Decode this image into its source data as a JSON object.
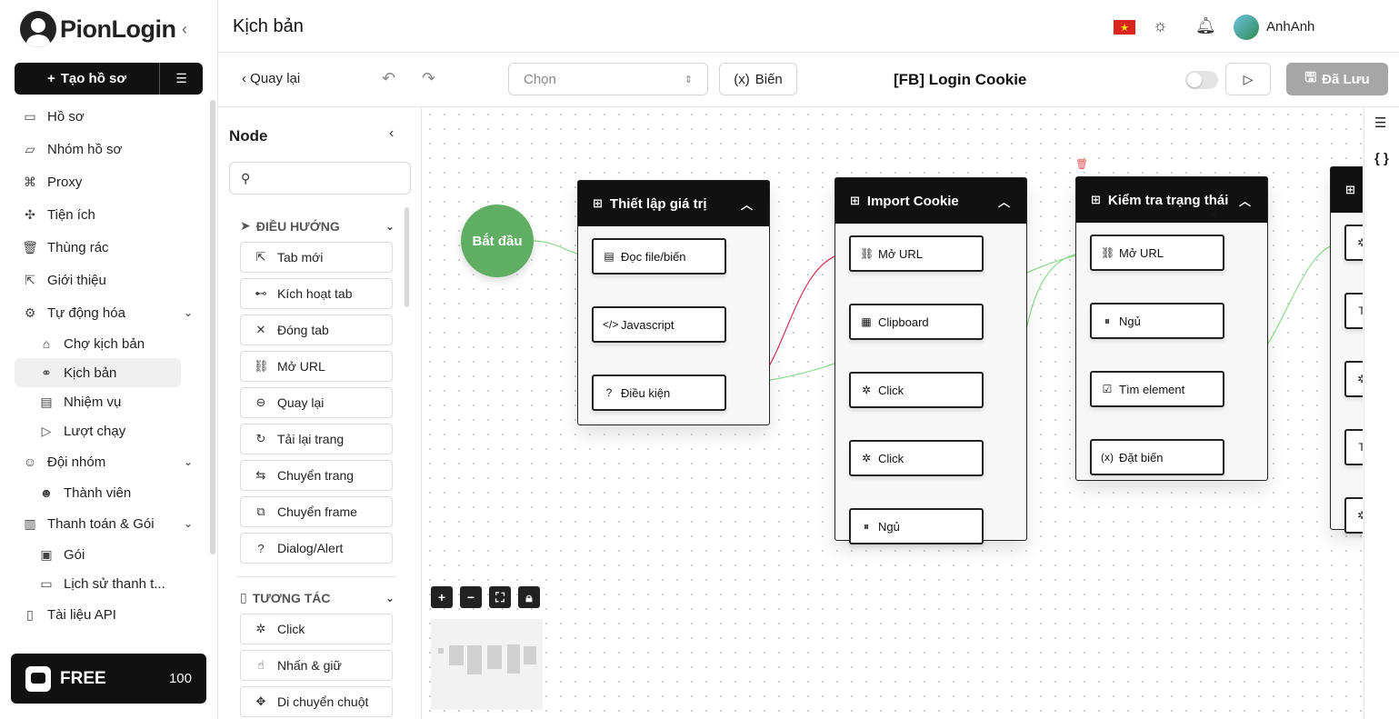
{
  "app": {
    "logo_text": "PionLogin"
  },
  "sidebar": {
    "create_label": "Tạo hồ sơ",
    "items": [
      {
        "label": "Hồ sơ",
        "icon": "profile-icon"
      },
      {
        "label": "Nhóm hồ sơ",
        "icon": "folder-icon"
      },
      {
        "label": "Proxy",
        "icon": "network-icon"
      },
      {
        "label": "Tiện ích",
        "icon": "puzzle-icon"
      },
      {
        "label": "Thùng rác",
        "icon": "trash-icon"
      },
      {
        "label": "Giới thiệu",
        "icon": "share-icon"
      },
      {
        "label": "Tự động hóa",
        "icon": "automation-icon"
      },
      {
        "label": "Chợ kịch bản",
        "icon": "store-icon"
      },
      {
        "label": "Kịch bản",
        "icon": "workflow-icon"
      },
      {
        "label": "Nhiệm vụ",
        "icon": "task-icon"
      },
      {
        "label": "Lượt chạy",
        "icon": "play-icon"
      },
      {
        "label": "Đội nhóm",
        "icon": "user-icon"
      },
      {
        "label": "Thành viên",
        "icon": "users-icon"
      },
      {
        "label": "Thanh toán & Gói",
        "icon": "receipt-icon"
      },
      {
        "label": "Gói",
        "icon": "package-icon"
      },
      {
        "label": "Lịch sử thanh t...",
        "icon": "history-icon"
      },
      {
        "label": "Tài liệu API",
        "icon": "book-icon"
      }
    ],
    "plan": {
      "label": "FREE",
      "count": "100"
    }
  },
  "header": {
    "title": "Kịch bản",
    "user": "AnhAnh"
  },
  "toolbar": {
    "back_label": "Quay lại",
    "select_placeholder": "Chọn",
    "variables_label": "Biến",
    "script_name": "[FB] Login Cookie",
    "saved_label": "Đã Lưu"
  },
  "panel": {
    "title": "Node",
    "categories": [
      "ĐIỀU HƯỚNG",
      "TƯƠNG TÁC"
    ],
    "navigation_items": [
      "Tab mới",
      "Kích hoạt tab",
      "Đóng tab",
      "Mở URL",
      "Quay lại",
      "Tải lại trang",
      "Chuyển trang",
      "Chuyển frame",
      "Dialog/Alert"
    ],
    "interaction_items": [
      "Click",
      "Nhấn & giữ",
      "Di chuyển chuột"
    ]
  },
  "canvas": {
    "start_label": "Bắt đầu",
    "groups": [
      {
        "title": "Thiết lập giá trị",
        "blocks": [
          "Đọc file/biến",
          "Javascript",
          "Điều kiện"
        ]
      },
      {
        "title": "Import Cookie",
        "blocks": [
          "Mở URL",
          "Clipboard",
          "Click",
          "Click",
          "Ngủ"
        ]
      },
      {
        "title": "Kiểm tra trạng thái",
        "blocks": [
          "Mở URL",
          "Ngủ",
          "Tìm element",
          "Đặt biến"
        ]
      }
    ]
  },
  "colors": {
    "start": "#5fae63",
    "edge_success": "#8fdc8f",
    "edge_fail": "#d6335a",
    "saved_bg": "#a6a6a6"
  }
}
